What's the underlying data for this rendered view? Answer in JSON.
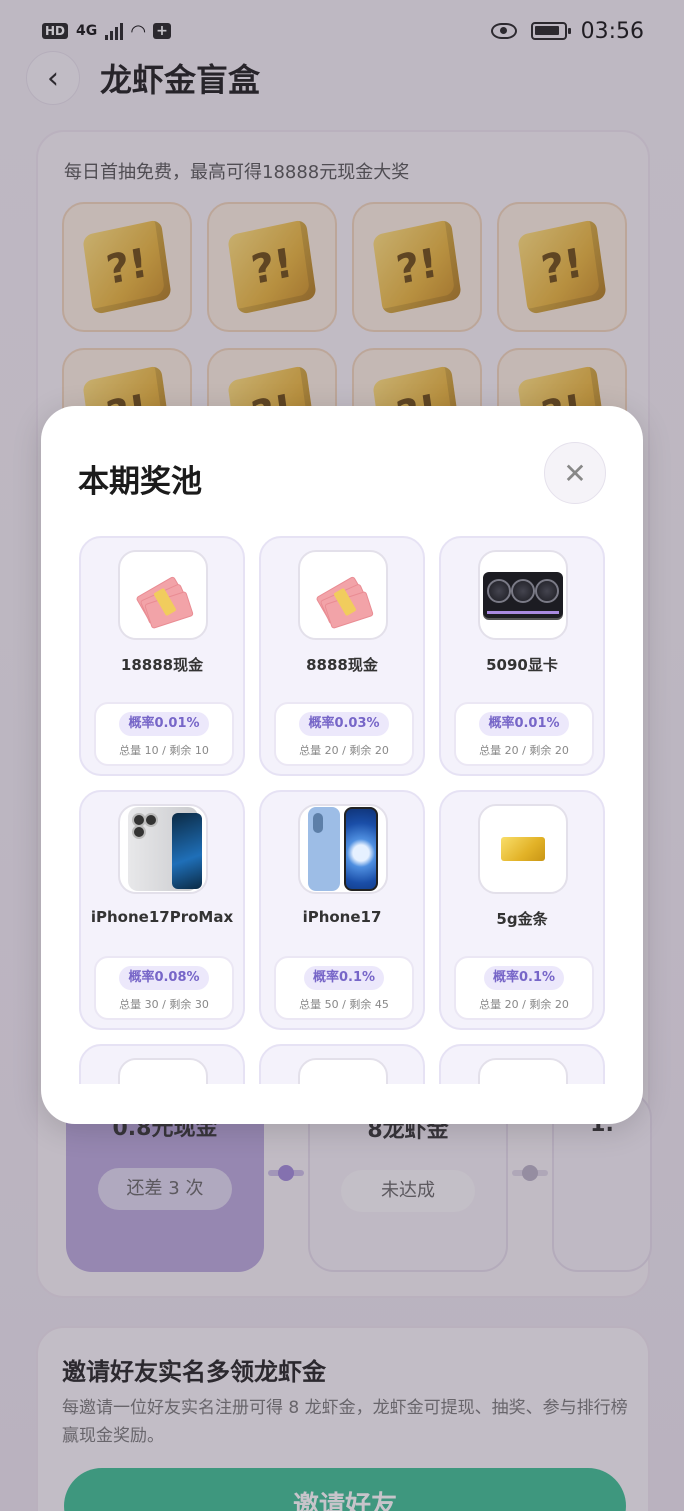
{
  "status_bar": {
    "network_badge": "HD",
    "network_type": "4G",
    "time": "03:56"
  },
  "header": {
    "back_icon": "chevron-left-icon",
    "title": "龙虾金盲盒"
  },
  "draw_card": {
    "note": "每日首抽免费，最高可得18888元现金大奖",
    "box_symbol": "?!"
  },
  "progress": [
    {
      "amount": "0.8元现金",
      "status": "还差 3 次"
    },
    {
      "amount": "8龙虾金",
      "status": "未达成"
    },
    {
      "amount": "1.",
      "status": ""
    }
  ],
  "invite": {
    "title": "邀请好友实名多领龙虾金",
    "desc": "每邀请一位好友实名注册可得 8 龙虾金，龙虾金可提现、抽奖、参与排行榜赢现金奖励。",
    "button": "邀请好友"
  },
  "modal": {
    "title": "本期奖池",
    "close_icon": "close-icon",
    "prizes": [
      {
        "name": "18888现金",
        "prob": "概率0.01%",
        "stock": "总量 10 / 剩余 10",
        "icon": "cash-bundle-icon"
      },
      {
        "name": "8888现金",
        "prob": "概率0.03%",
        "stock": "总量 20 / 剩余 20",
        "icon": "cash-bundle-icon"
      },
      {
        "name": "5090显卡",
        "prob": "概率0.01%",
        "stock": "总量 20 / 剩余 20",
        "icon": "graphics-card-icon"
      },
      {
        "name": "iPhone17ProMax",
        "prob": "概率0.08%",
        "stock": "总量 30 / 剩余 30",
        "icon": "phone-icon"
      },
      {
        "name": "iPhone17",
        "prob": "概率0.1%",
        "stock": "总量 50 / 剩余 45",
        "icon": "phone-icon"
      },
      {
        "name": "5g金条",
        "prob": "概率0.1%",
        "stock": "总量 20 / 剩余 20",
        "icon": "gold-bar-icon"
      }
    ]
  },
  "colors": {
    "accent_purple": "#7766c8",
    "invite_green": "#3bbf92",
    "gold": "#e9b53a"
  }
}
